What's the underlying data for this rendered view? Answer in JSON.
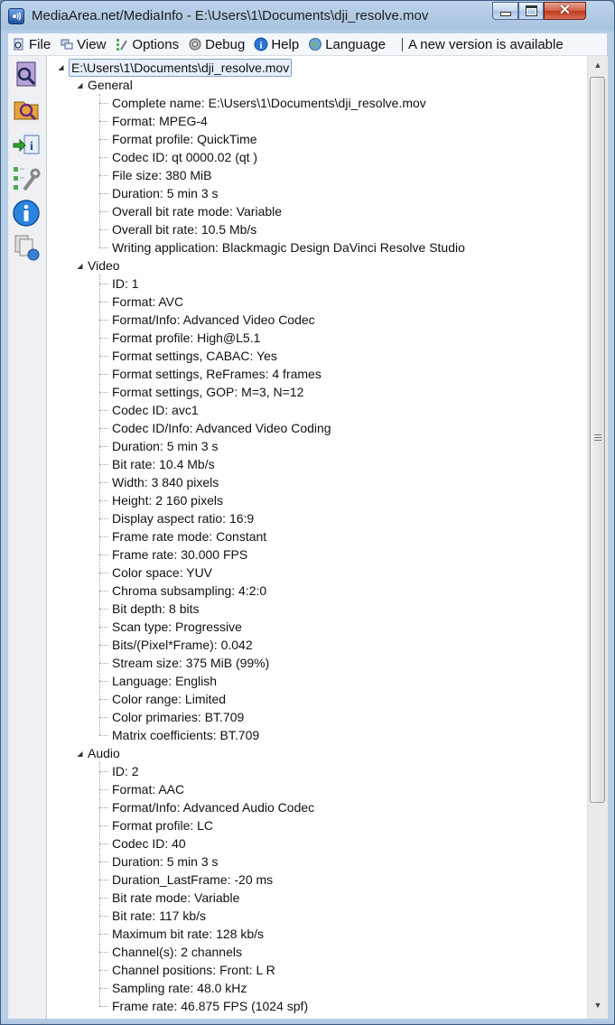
{
  "window": {
    "title": "MediaArea.net/MediaInfo - E:\\Users\\1\\Documents\\dji_resolve.mov"
  },
  "menubar": {
    "items": [
      {
        "label": "File",
        "icon": "file-icon"
      },
      {
        "label": "View",
        "icon": "view-icon"
      },
      {
        "label": "Options",
        "icon": "options-icon"
      },
      {
        "label": "Debug",
        "icon": "debug-icon"
      },
      {
        "label": "Help",
        "icon": "help-icon"
      },
      {
        "label": "Language",
        "icon": "language-icon"
      }
    ],
    "notice": "A new version is available"
  },
  "sidebar": {
    "buttons": [
      "open-file-icon",
      "open-folder-icon",
      "export-icon",
      "preferences-icon",
      "about-icon",
      "sheet-view-icon"
    ]
  },
  "tree": {
    "root": "E:\\Users\\1\\Documents\\dji_resolve.mov",
    "sections": [
      {
        "name": "General",
        "items": [
          "Complete name: E:\\Users\\1\\Documents\\dji_resolve.mov",
          "Format: MPEG-4",
          "Format profile: QuickTime",
          "Codec ID: qt   0000.02 (qt  )",
          "File size: 380 MiB",
          "Duration: 5 min 3 s",
          "Overall bit rate mode: Variable",
          "Overall bit rate: 10.5 Mb/s",
          "Writing application: Blackmagic Design DaVinci Resolve Studio"
        ]
      },
      {
        "name": "Video",
        "items": [
          "ID: 1",
          "Format: AVC",
          "Format/Info: Advanced Video Codec",
          "Format profile: High@L5.1",
          "Format settings, CABAC: Yes",
          "Format settings, ReFrames: 4 frames",
          "Format settings, GOP: M=3, N=12",
          "Codec ID: avc1",
          "Codec ID/Info: Advanced Video Coding",
          "Duration: 5 min 3 s",
          "Bit rate: 10.4 Mb/s",
          "Width: 3 840 pixels",
          "Height: 2 160 pixels",
          "Display aspect ratio: 16:9",
          "Frame rate mode: Constant",
          "Frame rate: 30.000 FPS",
          "Color space: YUV",
          "Chroma subsampling: 4:2:0",
          "Bit depth: 8 bits",
          "Scan type: Progressive",
          "Bits/(Pixel*Frame): 0.042",
          "Stream size: 375 MiB (99%)",
          "Language: English",
          "Color range: Limited",
          "Color primaries: BT.709",
          "Matrix coefficients: BT.709"
        ]
      },
      {
        "name": "Audio",
        "items": [
          "ID: 2",
          "Format: AAC",
          "Format/Info: Advanced Audio Codec",
          "Format profile: LC",
          "Codec ID: 40",
          "Duration: 5 min 3 s",
          "Duration_LastFrame: -20 ms",
          "Bit rate mode: Variable",
          "Bit rate: 117 kb/s",
          "Maximum bit rate: 128 kb/s",
          "Channel(s): 2 channels",
          "Channel positions: Front: L R",
          "Sampling rate: 48.0 kHz",
          "Frame rate: 46.875 FPS (1024 spf)"
        ]
      }
    ]
  }
}
